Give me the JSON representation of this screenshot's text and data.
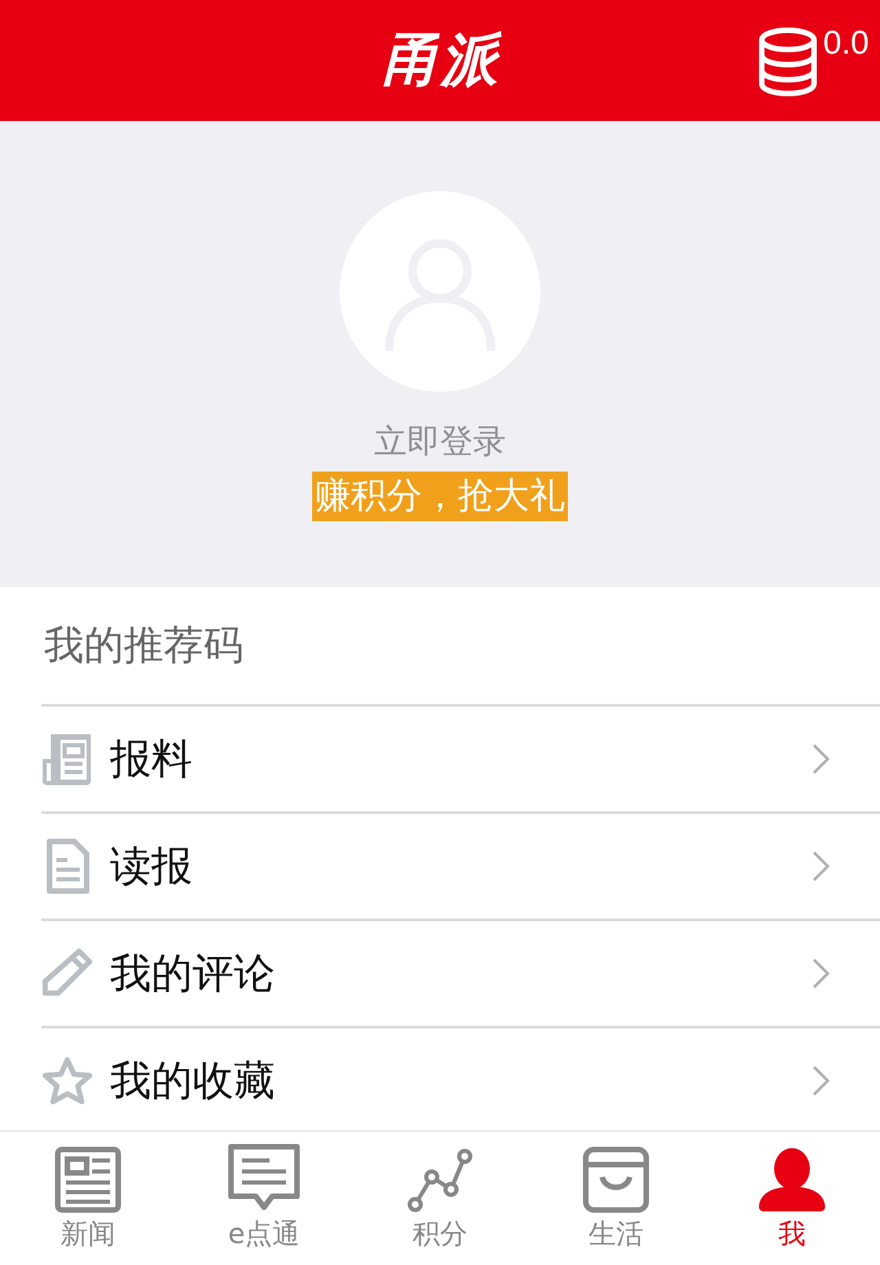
{
  "header": {
    "logo": "甬派",
    "points": "0.0"
  },
  "profile": {
    "login": "立即登录",
    "promo": "赚积分，抢大礼"
  },
  "menu": [
    {
      "label": "我的推荐码",
      "kind": "plain"
    },
    {
      "label": "报料",
      "kind": "link"
    },
    {
      "label": "读报",
      "kind": "link"
    },
    {
      "label": "我的评论",
      "kind": "link"
    },
    {
      "label": "我的收藏",
      "kind": "link"
    }
  ],
  "tabs": [
    {
      "label": "新闻",
      "selected": false
    },
    {
      "label": "e点通",
      "selected": false
    },
    {
      "label": "积分",
      "selected": false
    },
    {
      "label": "生活",
      "selected": false
    },
    {
      "label": "我",
      "selected": true
    }
  ]
}
